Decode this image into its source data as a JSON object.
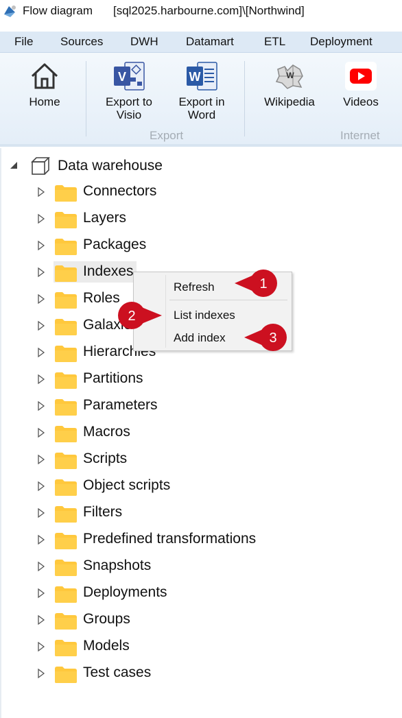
{
  "window": {
    "title": "Flow diagram",
    "connection": "[sql2025.harbourne.com]\\[Northwind]"
  },
  "menu": [
    "File",
    "Sources",
    "DWH",
    "Datamart",
    "ETL",
    "Deployment"
  ],
  "ribbon": {
    "home": "Home",
    "export_visio": [
      "Export to",
      "Visio"
    ],
    "export_word": [
      "Export in",
      "Word"
    ],
    "export_group": "Export",
    "wikipedia": "Wikipedia",
    "videos": "Videos",
    "internet_group": "Internet"
  },
  "tree": {
    "root": "Data warehouse",
    "nodes": [
      "Connectors",
      "Layers",
      "Packages",
      "Indexes",
      "Roles",
      "Galaxies",
      "Hierarchies",
      "Partitions",
      "Parameters",
      "Macros",
      "Scripts",
      "Object scripts",
      "Filters",
      "Predefined transformations",
      "Snapshots",
      "Deployments",
      "Groups",
      "Models",
      "Test cases"
    ]
  },
  "context_menu": {
    "items": [
      "Refresh",
      "List indexes",
      "Add index"
    ]
  },
  "callouts": [
    "1",
    "2",
    "3"
  ],
  "colors": {
    "folder": "#ffc83d",
    "callout": "#cc1020",
    "ribbon_bg": "#e4eef8",
    "menubar_bg": "#dde9f5"
  }
}
